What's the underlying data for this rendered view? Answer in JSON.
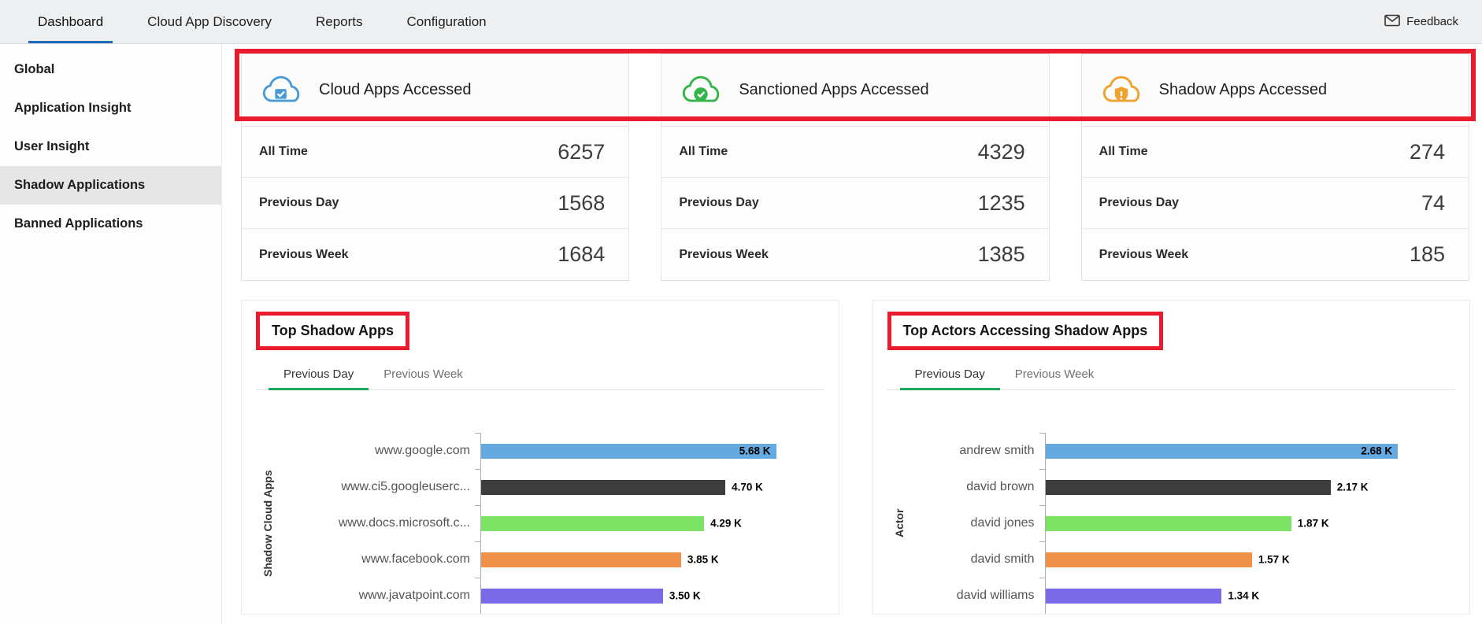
{
  "annotation_color": "#ea1b2d",
  "topnav": {
    "tabs": [
      {
        "label": "Dashboard",
        "active": true
      },
      {
        "label": "Cloud App Discovery",
        "active": false
      },
      {
        "label": "Reports",
        "active": false
      },
      {
        "label": "Configuration",
        "active": false
      }
    ],
    "feedback": {
      "label": "Feedback",
      "icon": "envelope-icon"
    }
  },
  "sidebar": {
    "items": [
      {
        "label": "Global",
        "active": false
      },
      {
        "label": "Application Insight",
        "active": false
      },
      {
        "label": "User Insight",
        "active": false
      },
      {
        "label": "Shadow Applications",
        "active": true
      },
      {
        "label": "Banned Applications",
        "active": false
      }
    ]
  },
  "summary_cards": [
    {
      "title": "Cloud Apps Accessed",
      "icon": "cloud-check-icon",
      "icon_color": "#4a9bd5",
      "rows": [
        {
          "label": "All Time",
          "value": "6257"
        },
        {
          "label": "Previous Day",
          "value": "1568"
        },
        {
          "label": "Previous Week",
          "value": "1684"
        }
      ]
    },
    {
      "title": "Sanctioned Apps Accessed",
      "icon": "cloud-shield-check-icon",
      "icon_color": "#35b44a",
      "rows": [
        {
          "label": "All Time",
          "value": "4329"
        },
        {
          "label": "Previous Day",
          "value": "1235"
        },
        {
          "label": "Previous Week",
          "value": "1385"
        }
      ]
    },
    {
      "title": "Shadow Apps Accessed",
      "icon": "cloud-shield-alert-icon",
      "icon_color": "#f0a12e",
      "rows": [
        {
          "label": "All Time",
          "value": "274"
        },
        {
          "label": "Previous Day",
          "value": "74"
        },
        {
          "label": "Previous Week",
          "value": "185"
        }
      ]
    }
  ],
  "chart_data": [
    {
      "type": "bar",
      "orientation": "horizontal",
      "title": "Top Shadow Apps",
      "tabs": [
        {
          "label": "Previous Day",
          "active": true
        },
        {
          "label": "Previous Week",
          "active": false
        }
      ],
      "ylabel": "Shadow Cloud Apps",
      "axis_max": 5680,
      "bars": [
        {
          "category": "www.google.com",
          "value": 5680,
          "label": "5.68 K",
          "color": "#64a9e0",
          "label_inside": true
        },
        {
          "category": "www.ci5.googleuserc...",
          "value": 4700,
          "label": "4.70 K",
          "color": "#3d3d3d",
          "label_inside": false
        },
        {
          "category": "www.docs.microsoft.c...",
          "value": 4290,
          "label": "4.29 K",
          "color": "#7ce464",
          "label_inside": false
        },
        {
          "category": "www.facebook.com",
          "value": 3850,
          "label": "3.85 K",
          "color": "#ef9148",
          "label_inside": false
        },
        {
          "category": "www.javatpoint.com",
          "value": 3500,
          "label": "3.50 K",
          "color": "#7a6ae8",
          "label_inside": false
        }
      ]
    },
    {
      "type": "bar",
      "orientation": "horizontal",
      "title": "Top Actors Accessing Shadow Apps",
      "tabs": [
        {
          "label": "Previous Day",
          "active": true
        },
        {
          "label": "Previous Week",
          "active": false
        }
      ],
      "ylabel": "Actor",
      "axis_max": 2680,
      "bars": [
        {
          "category": "andrew smith",
          "value": 2680,
          "label": "2.68 K",
          "color": "#64a9e0",
          "label_inside": true
        },
        {
          "category": "david brown",
          "value": 2170,
          "label": "2.17 K",
          "color": "#3d3d3d",
          "label_inside": false
        },
        {
          "category": "david jones",
          "value": 1870,
          "label": "1.87 K",
          "color": "#7ce464",
          "label_inside": false
        },
        {
          "category": "david smith",
          "value": 1570,
          "label": "1.57 K",
          "color": "#ef9148",
          "label_inside": false
        },
        {
          "category": "david williams",
          "value": 1340,
          "label": "1.34 K",
          "color": "#7a6ae8",
          "label_inside": false
        }
      ]
    }
  ]
}
